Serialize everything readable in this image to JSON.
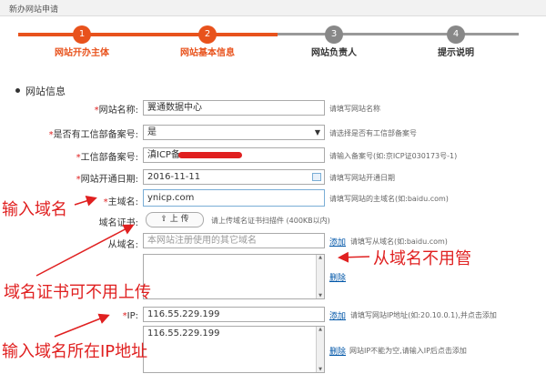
{
  "header": {
    "title": "新办网站申请"
  },
  "steps": [
    {
      "num": "1",
      "label": "网站开办主体"
    },
    {
      "num": "2",
      "label": "网站基本信息"
    },
    {
      "num": "3",
      "label": "网站负责人"
    },
    {
      "num": "4",
      "label": "提示说明"
    }
  ],
  "colors": {
    "accent": "#e8521c",
    "inactive": "#999999",
    "annotation": "#e02020"
  },
  "section": {
    "title": "网站信息"
  },
  "form": {
    "site_name": {
      "label": "网站名称:",
      "value": "翼通数据中心",
      "hint": "请填写网站名称"
    },
    "filing": {
      "label": "是否有工信部备案号:",
      "value": "是",
      "hint": "请选择是否有工信部备案号"
    },
    "icp": {
      "label": "工信部备案号:",
      "value": "滇ICP备",
      "hint": "请输入备案号(如:京ICP证030173号-1)"
    },
    "open_date": {
      "label": "网站开通日期:",
      "value": "2016-11-11",
      "hint": "请填写网站开通日期"
    },
    "domain": {
      "label": "主域名:",
      "value": "ynicp.com",
      "hint": "请填写网站的主域名(如:baidu.com)"
    },
    "cert": {
      "label": "域名证书:",
      "button": "上 传",
      "hint": "请上传域名证书扫描件 (400KB以内)"
    },
    "sub_domain": {
      "label": "从域名:",
      "placeholder": "本网站注册使用的其它域名",
      "add": "添加",
      "hint": "请填写从域名(如:baidu.com)",
      "delete": "删除"
    },
    "ip": {
      "label": "IP:",
      "value": "116.55.229.199",
      "add": "添加",
      "hint": "请填写网站IP地址(如:20.10.0.1),并点击添加",
      "list": "116.55.229.199",
      "delete": "删除",
      "delete_hint": "网站IP不能为空,请输入IP后点击添加"
    }
  },
  "annotations": {
    "domain": "输入域名",
    "subdomain": "从域名不用管",
    "cert": "域名证书可不用上传",
    "ip": "输入域名所在IP地址"
  }
}
